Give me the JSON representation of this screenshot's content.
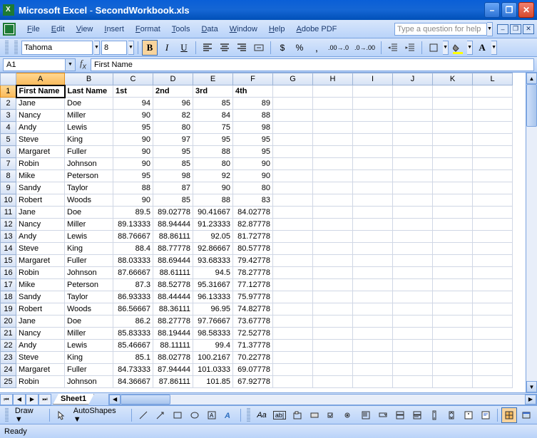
{
  "titlebar": {
    "app": "Microsoft Excel",
    "doc": "SecondWorkbook.xls"
  },
  "menu": [
    "File",
    "Edit",
    "View",
    "Insert",
    "Format",
    "Tools",
    "Data",
    "Window",
    "Help",
    "Adobe PDF"
  ],
  "help_placeholder": "Type a question for help",
  "font": {
    "name": "Tahoma",
    "size": "8"
  },
  "namebox": "A1",
  "formula": "First Name",
  "columns": [
    "A",
    "B",
    "C",
    "D",
    "E",
    "F",
    "G",
    "H",
    "I",
    "J",
    "K",
    "L"
  ],
  "headers": [
    "First Name",
    "Last Name",
    "1st",
    "2nd",
    "3rd",
    "4th"
  ],
  "rows": [
    [
      "Jane",
      "Doe",
      "94",
      "96",
      "85",
      "89"
    ],
    [
      "Nancy",
      "Miller",
      "90",
      "82",
      "84",
      "88"
    ],
    [
      "Andy",
      "Lewis",
      "95",
      "80",
      "75",
      "98"
    ],
    [
      "Steve",
      "King",
      "90",
      "97",
      "95",
      "95"
    ],
    [
      "Margaret",
      "Fuller",
      "90",
      "95",
      "88",
      "95"
    ],
    [
      "Robin",
      "Johnson",
      "90",
      "85",
      "80",
      "90"
    ],
    [
      "Mike",
      "Peterson",
      "95",
      "98",
      "92",
      "90"
    ],
    [
      "Sandy",
      "Taylor",
      "88",
      "87",
      "90",
      "80"
    ],
    [
      "Robert",
      "Woods",
      "90",
      "85",
      "88",
      "83"
    ],
    [
      "Jane",
      "Doe",
      "89.5",
      "89.02778",
      "90.41667",
      "84.02778"
    ],
    [
      "Nancy",
      "Miller",
      "89.13333",
      "88.94444",
      "91.23333",
      "82.87778"
    ],
    [
      "Andy",
      "Lewis",
      "88.76667",
      "88.86111",
      "92.05",
      "81.72778"
    ],
    [
      "Steve",
      "King",
      "88.4",
      "88.77778",
      "92.86667",
      "80.57778"
    ],
    [
      "Margaret",
      "Fuller",
      "88.03333",
      "88.69444",
      "93.68333",
      "79.42778"
    ],
    [
      "Robin",
      "Johnson",
      "87.66667",
      "88.61111",
      "94.5",
      "78.27778"
    ],
    [
      "Mike",
      "Peterson",
      "87.3",
      "88.52778",
      "95.31667",
      "77.12778"
    ],
    [
      "Sandy",
      "Taylor",
      "86.93333",
      "88.44444",
      "96.13333",
      "75.97778"
    ],
    [
      "Robert",
      "Woods",
      "86.56667",
      "88.36111",
      "96.95",
      "74.82778"
    ],
    [
      "Jane",
      "Doe",
      "86.2",
      "88.27778",
      "97.76667",
      "73.67778"
    ],
    [
      "Nancy",
      "Miller",
      "85.83333",
      "88.19444",
      "98.58333",
      "72.52778"
    ],
    [
      "Andy",
      "Lewis",
      "85.46667",
      "88.11111",
      "99.4",
      "71.37778"
    ],
    [
      "Steve",
      "King",
      "85.1",
      "88.02778",
      "100.2167",
      "70.22778"
    ],
    [
      "Margaret",
      "Fuller",
      "84.73333",
      "87.94444",
      "101.0333",
      "69.07778"
    ],
    [
      "Robin",
      "Johnson",
      "84.36667",
      "87.86111",
      "101.85",
      "67.92778"
    ]
  ],
  "sheet_tab": "Sheet1",
  "draw_label": "Draw",
  "autoshapes_label": "AutoShapes",
  "status": "Ready"
}
